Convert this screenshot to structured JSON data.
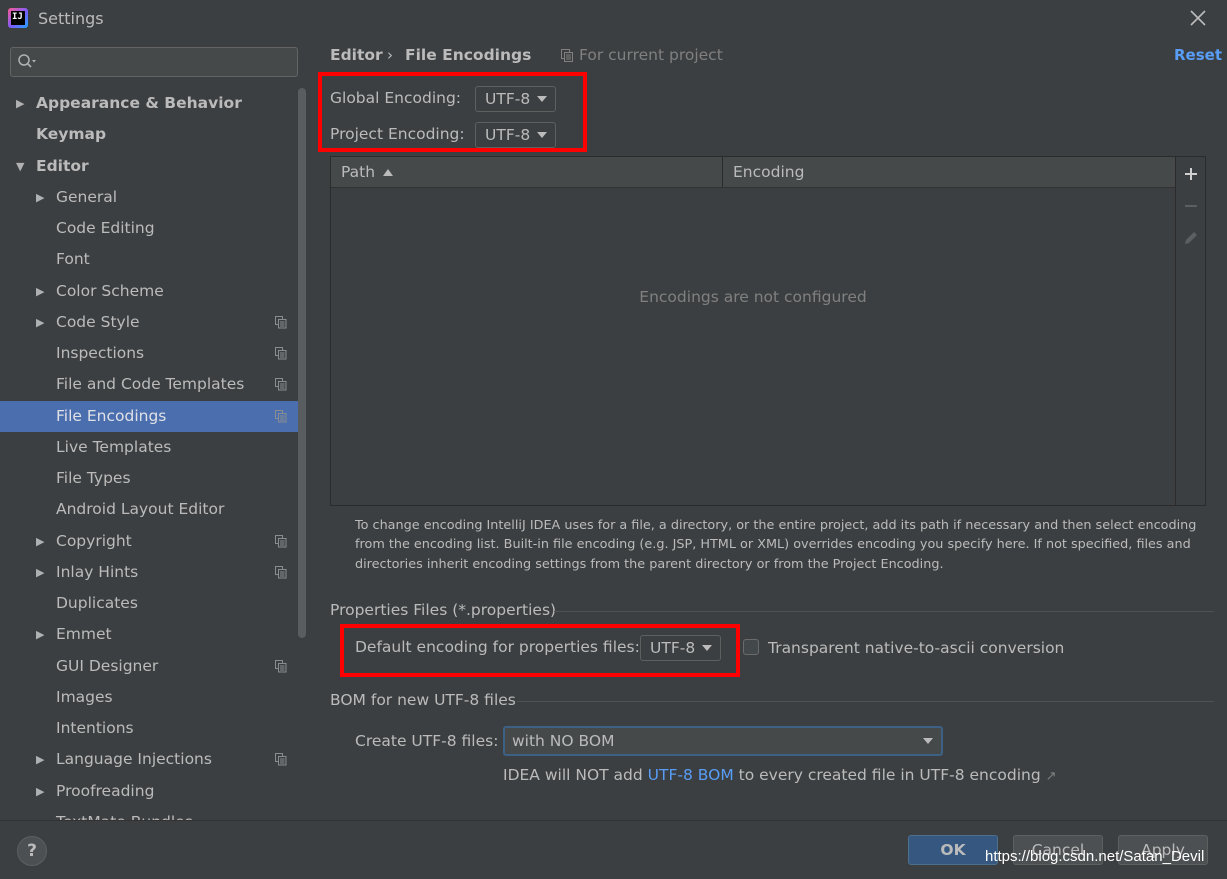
{
  "window": {
    "title": "Settings"
  },
  "sidebar": {
    "search_placeholder": "",
    "items": [
      {
        "label": "Appearance & Behavior",
        "bold": true,
        "arrow": "right",
        "depth": 0,
        "project": false
      },
      {
        "label": "Keymap",
        "bold": true,
        "arrow": "none",
        "depth": 0,
        "project": false
      },
      {
        "label": "Editor",
        "bold": true,
        "arrow": "down",
        "depth": 0,
        "project": false
      },
      {
        "label": "General",
        "bold": false,
        "arrow": "right",
        "depth": 1,
        "project": false
      },
      {
        "label": "Code Editing",
        "bold": false,
        "arrow": "none",
        "depth": 1,
        "project": false
      },
      {
        "label": "Font",
        "bold": false,
        "arrow": "none",
        "depth": 1,
        "project": false
      },
      {
        "label": "Color Scheme",
        "bold": false,
        "arrow": "right",
        "depth": 1,
        "project": false
      },
      {
        "label": "Code Style",
        "bold": false,
        "arrow": "right",
        "depth": 1,
        "project": true
      },
      {
        "label": "Inspections",
        "bold": false,
        "arrow": "none",
        "depth": 1,
        "project": true
      },
      {
        "label": "File and Code Templates",
        "bold": false,
        "arrow": "none",
        "depth": 1,
        "project": true
      },
      {
        "label": "File Encodings",
        "bold": false,
        "arrow": "none",
        "depth": 1,
        "project": true,
        "selected": true
      },
      {
        "label": "Live Templates",
        "bold": false,
        "arrow": "none",
        "depth": 1,
        "project": false
      },
      {
        "label": "File Types",
        "bold": false,
        "arrow": "none",
        "depth": 1,
        "project": false
      },
      {
        "label": "Android Layout Editor",
        "bold": false,
        "arrow": "none",
        "depth": 1,
        "project": false
      },
      {
        "label": "Copyright",
        "bold": false,
        "arrow": "right",
        "depth": 1,
        "project": true
      },
      {
        "label": "Inlay Hints",
        "bold": false,
        "arrow": "right",
        "depth": 1,
        "project": true
      },
      {
        "label": "Duplicates",
        "bold": false,
        "arrow": "none",
        "depth": 1,
        "project": false
      },
      {
        "label": "Emmet",
        "bold": false,
        "arrow": "right",
        "depth": 1,
        "project": false
      },
      {
        "label": "GUI Designer",
        "bold": false,
        "arrow": "none",
        "depth": 1,
        "project": true
      },
      {
        "label": "Images",
        "bold": false,
        "arrow": "none",
        "depth": 1,
        "project": false
      },
      {
        "label": "Intentions",
        "bold": false,
        "arrow": "none",
        "depth": 1,
        "project": false
      },
      {
        "label": "Language Injections",
        "bold": false,
        "arrow": "right",
        "depth": 1,
        "project": true
      },
      {
        "label": "Proofreading",
        "bold": false,
        "arrow": "right",
        "depth": 1,
        "project": false
      },
      {
        "label": "TextMate Bundles",
        "bold": false,
        "arrow": "none",
        "depth": 1,
        "project": false
      }
    ]
  },
  "main": {
    "breadcrumb": {
      "parent": "Editor",
      "separator": "›",
      "current": "File Encodings"
    },
    "scope": "For current project",
    "reset_label": "Reset",
    "global_encoding": {
      "label": "Global Encoding:",
      "value": "UTF-8"
    },
    "project_encoding": {
      "label": "Project Encoding:",
      "value": "UTF-8"
    },
    "table": {
      "columns": [
        "Path",
        "Encoding"
      ],
      "sorted_column": "Path",
      "sort_direction": "ascending",
      "empty_text": "Encodings are not configured"
    },
    "help_text": "To change encoding IntelliJ IDEA uses for a file, a directory, or the entire project, add its path if necessary and then select encoding from the encoding list. Built-in file encoding (e.g. JSP, HTML or XML) overrides encoding you specify here. If not specified, files and directories inherit encoding settings from the parent directory or from the Project Encoding.",
    "properties": {
      "section_title": "Properties Files (*.properties)",
      "default_label": "Default encoding for properties files:",
      "default_value": "UTF-8",
      "transparent_label": "Transparent native-to-ascii conversion",
      "transparent_checked": false
    },
    "bom": {
      "section_title": "BOM for new UTF-8 files",
      "create_label": "Create UTF-8 files:",
      "create_value": "with NO BOM",
      "note_prefix": "IDEA will NOT add ",
      "note_link": "UTF-8 BOM",
      "note_suffix": " to every created file in UTF-8 encoding",
      "note_arrow": "↗"
    }
  },
  "footer": {
    "help_label": "?",
    "ok_label": "OK",
    "cancel_label": "Cancel",
    "apply_label": "Apply",
    "watermark": "https://blog.csdn.net/Satan_Devil"
  },
  "colors": {
    "background": "#3c3f41",
    "selection": "#4b6eaf",
    "link": "#589df6",
    "highlight_box": "#ff0000",
    "ok_button": "#365880"
  }
}
